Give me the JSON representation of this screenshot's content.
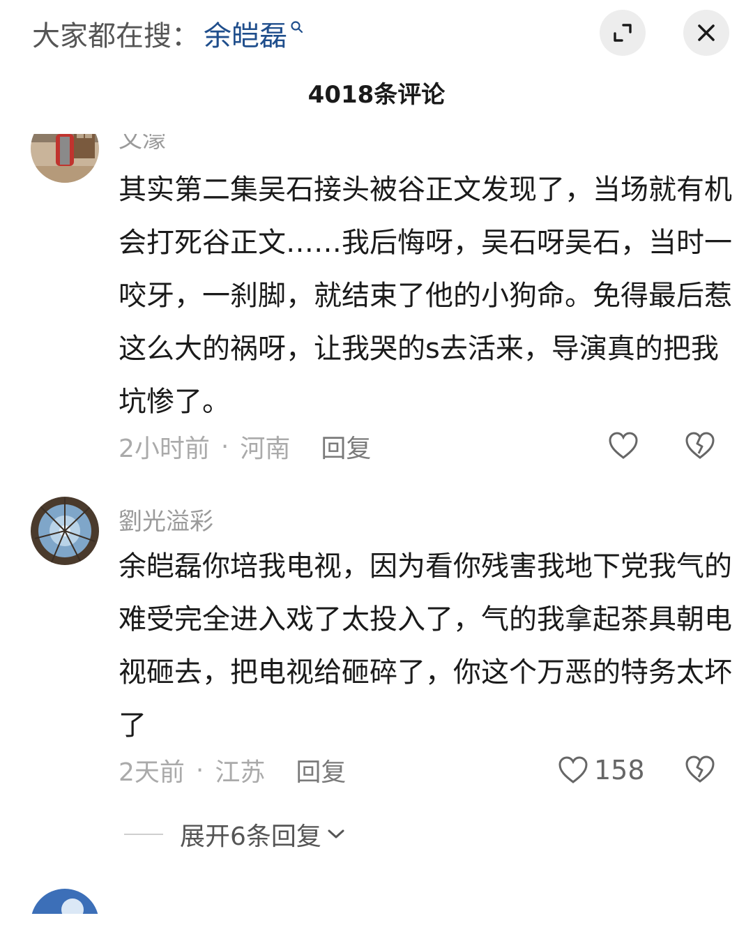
{
  "header": {
    "search_prefix": "大家都在搜：",
    "search_term": "余皑磊",
    "search_icon": "search-icon",
    "expand_icon": "expand-icon",
    "close_icon": "close-icon"
  },
  "comment_count": "4018条评论",
  "comments": [
    {
      "username": "文濛",
      "text": "其实第二集吴石接头被谷正文发现了，当场就有机会打死谷正文……我后悔呀，吴石呀吴石，当时一咬牙，一刹脚，就结束了他的小狗命。免得最后惹这么大的祸呀，让我哭的s去活来，导演真的把我坑惨了。",
      "time": "2小时前",
      "location": "河南",
      "reply_label": "回复",
      "like_count": ""
    },
    {
      "username": "劉光溢彩",
      "text": "余皑磊你培我电视，因为看你残害我地下党我气的难受完全进入戏了太投入了，气的我拿起茶具朝电视砸去，把电视给砸碎了，你这个万恶的特务太坏了",
      "time": "2天前",
      "location": "江苏",
      "reply_label": "回复",
      "like_count": "158",
      "expand_replies": "展开6条回复"
    }
  ],
  "separator": "·",
  "colors": {
    "accent": "#1f4e8c",
    "text": "#1a1a1a",
    "muted": "#9a9a9a",
    "button_bg": "#ededed"
  }
}
